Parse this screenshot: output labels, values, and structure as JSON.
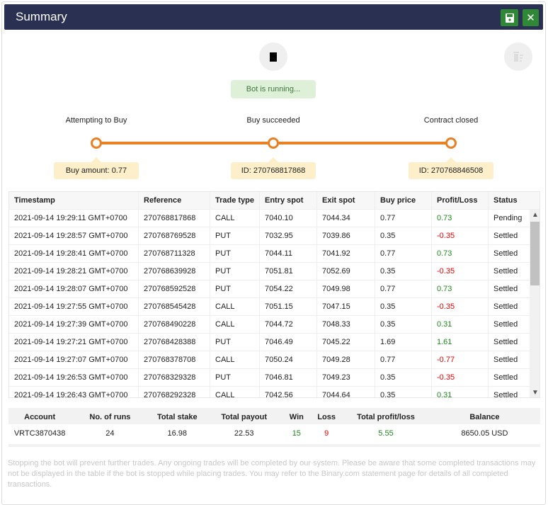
{
  "header": {
    "title": "Summary",
    "save_icon": "save-icon",
    "close_icon": "close-icon"
  },
  "controls": {
    "stop_icon": "stop-icon",
    "clear_icon": "trash-icon",
    "status": "Bot is running..."
  },
  "timeline": {
    "accent": "#e98024",
    "steps": [
      {
        "label": "Attempting to Buy",
        "info": "Buy amount: 0.77"
      },
      {
        "label": "Buy succeeded",
        "info": "ID: 270768817868"
      },
      {
        "label": "Contract closed",
        "info": "ID: 270768846508"
      }
    ]
  },
  "table": {
    "headers": [
      "Timestamp",
      "Reference",
      "Trade type",
      "Entry spot",
      "Exit spot",
      "Buy price",
      "Profit/Loss",
      "Status"
    ],
    "rows": [
      [
        "2021-09-14 19:29:11 GMT+0700",
        "270768817868",
        "CALL",
        "7040.10",
        "7044.34",
        "0.77",
        "0.73",
        "Pending"
      ],
      [
        "2021-09-14 19:28:57 GMT+0700",
        "270768769528",
        "PUT",
        "7032.95",
        "7039.86",
        "0.35",
        "-0.35",
        "Settled"
      ],
      [
        "2021-09-14 19:28:41 GMT+0700",
        "270768711328",
        "PUT",
        "7044.11",
        "7041.92",
        "0.77",
        "0.73",
        "Settled"
      ],
      [
        "2021-09-14 19:28:21 GMT+0700",
        "270768639928",
        "PUT",
        "7051.81",
        "7052.69",
        "0.35",
        "-0.35",
        "Settled"
      ],
      [
        "2021-09-14 19:28:07 GMT+0700",
        "270768592528",
        "PUT",
        "7054.22",
        "7049.98",
        "0.77",
        "0.73",
        "Settled"
      ],
      [
        "2021-09-14 19:27:55 GMT+0700",
        "270768545428",
        "CALL",
        "7051.15",
        "7047.15",
        "0.35",
        "-0.35",
        "Settled"
      ],
      [
        "2021-09-14 19:27:39 GMT+0700",
        "270768490228",
        "CALL",
        "7044.72",
        "7048.33",
        "0.35",
        "0.31",
        "Settled"
      ],
      [
        "2021-09-14 19:27:21 GMT+0700",
        "270768428388",
        "PUT",
        "7046.49",
        "7045.22",
        "1.69",
        "1.61",
        "Settled"
      ],
      [
        "2021-09-14 19:27:07 GMT+0700",
        "270768378708",
        "CALL",
        "7050.24",
        "7049.28",
        "0.77",
        "-0.77",
        "Settled"
      ],
      [
        "2021-09-14 19:26:53 GMT+0700",
        "270768329328",
        "PUT",
        "7046.81",
        "7049.23",
        "0.35",
        "-0.35",
        "Settled"
      ],
      [
        "2021-09-14 19:26:43 GMT+0700",
        "270768292328",
        "CALL",
        "7042.56",
        "7044.64",
        "0.35",
        "0.31",
        "Settled"
      ]
    ]
  },
  "summary": {
    "headers": [
      "Account",
      "No. of runs",
      "Total stake",
      "Total payout",
      "Win",
      "Loss",
      "Total profit/loss",
      "Balance"
    ],
    "values": [
      "VRTC3870438",
      "24",
      "16.98",
      "22.53",
      "15",
      "9",
      "5.55",
      "8650.05 USD"
    ]
  },
  "note": "Stopping the bot will prevent further trades. Any ongoing trades will be completed by our system. Please be aware that some completed transactions may not be displayed in the table if the bot is stopped while placing trades. You may refer to the Binary.com statement page for details of all completed transactions."
}
